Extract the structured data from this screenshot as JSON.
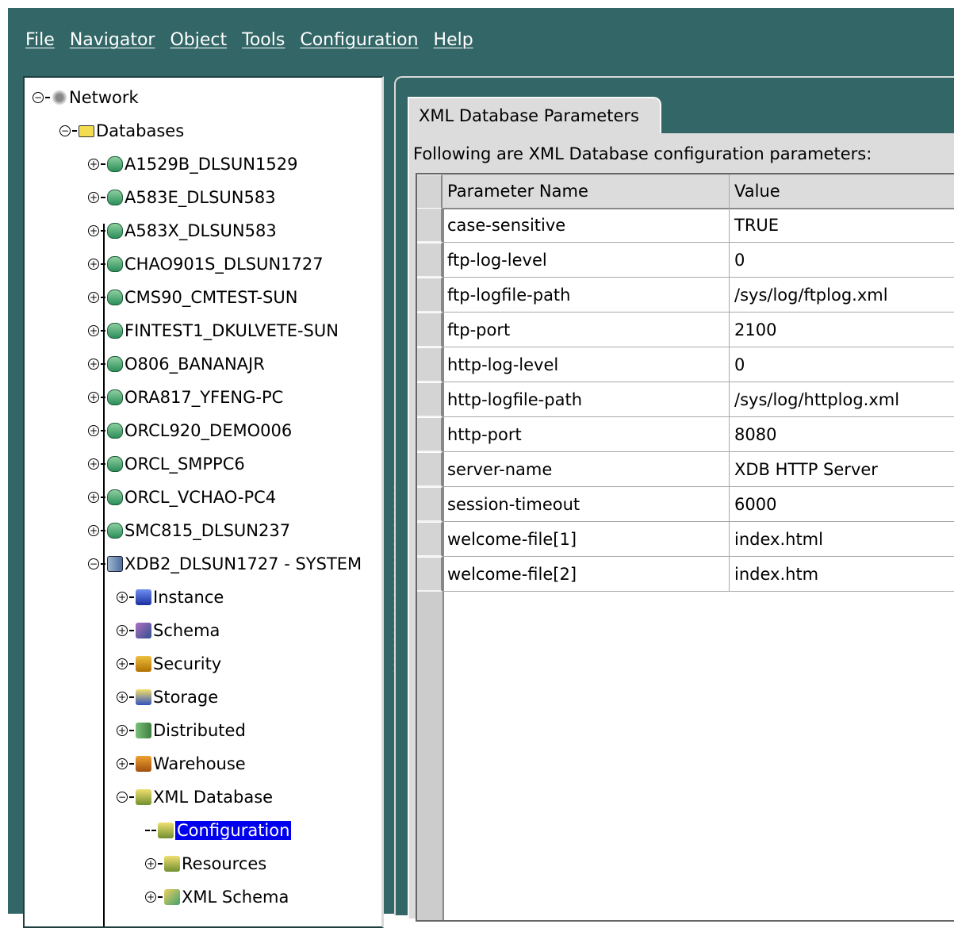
{
  "menu": [
    "File",
    "Navigator",
    "Object",
    "Tools",
    "Configuration",
    "Help"
  ],
  "tree": {
    "root": "Network",
    "databases_folder": "Databases",
    "databases": [
      "A1529B_DLSUN1529",
      "A583E_DLSUN583",
      "A583X_DLSUN583",
      "CHAO901S_DLSUN1727",
      "CMS90_CMTEST-SUN",
      "FINTEST1_DKULVETE-SUN",
      "O806_BANANAJR",
      "ORA817_YFENG-PC",
      "ORCL920_DEMO006",
      "ORCL_SMPPC6",
      "ORCL_VCHAO-PC4",
      "SMC815_DLSUN237"
    ],
    "expanded_db": "XDB2_DLSUN1727 - SYSTEM",
    "db_children": [
      "Instance",
      "Schema",
      "Security",
      "Storage",
      "Distributed",
      "Warehouse"
    ],
    "xml_database": "XML Database",
    "xml_children": [
      "Configuration",
      "Resources",
      "XML Schema"
    ],
    "selected": "Configuration"
  },
  "panel": {
    "tab_label": "XML Database Parameters",
    "description": "Following are XML Database configuration parameters:",
    "columns": [
      "Parameter Name",
      "Value"
    ],
    "rows": [
      [
        "case-sensitive",
        "TRUE"
      ],
      [
        "ftp-log-level",
        "0"
      ],
      [
        "ftp-logfile-path",
        "/sys/log/ftplog.xml"
      ],
      [
        "ftp-port",
        "2100"
      ],
      [
        "http-log-level",
        "0"
      ],
      [
        "http-logfile-path",
        "/sys/log/httplog.xml"
      ],
      [
        "http-port",
        "8080"
      ],
      [
        "server-name",
        "XDB HTTP Server"
      ],
      [
        "session-timeout",
        "6000"
      ],
      [
        "welcome-file[1]",
        "index.html"
      ],
      [
        "welcome-file[2]",
        "index.htm"
      ]
    ]
  }
}
